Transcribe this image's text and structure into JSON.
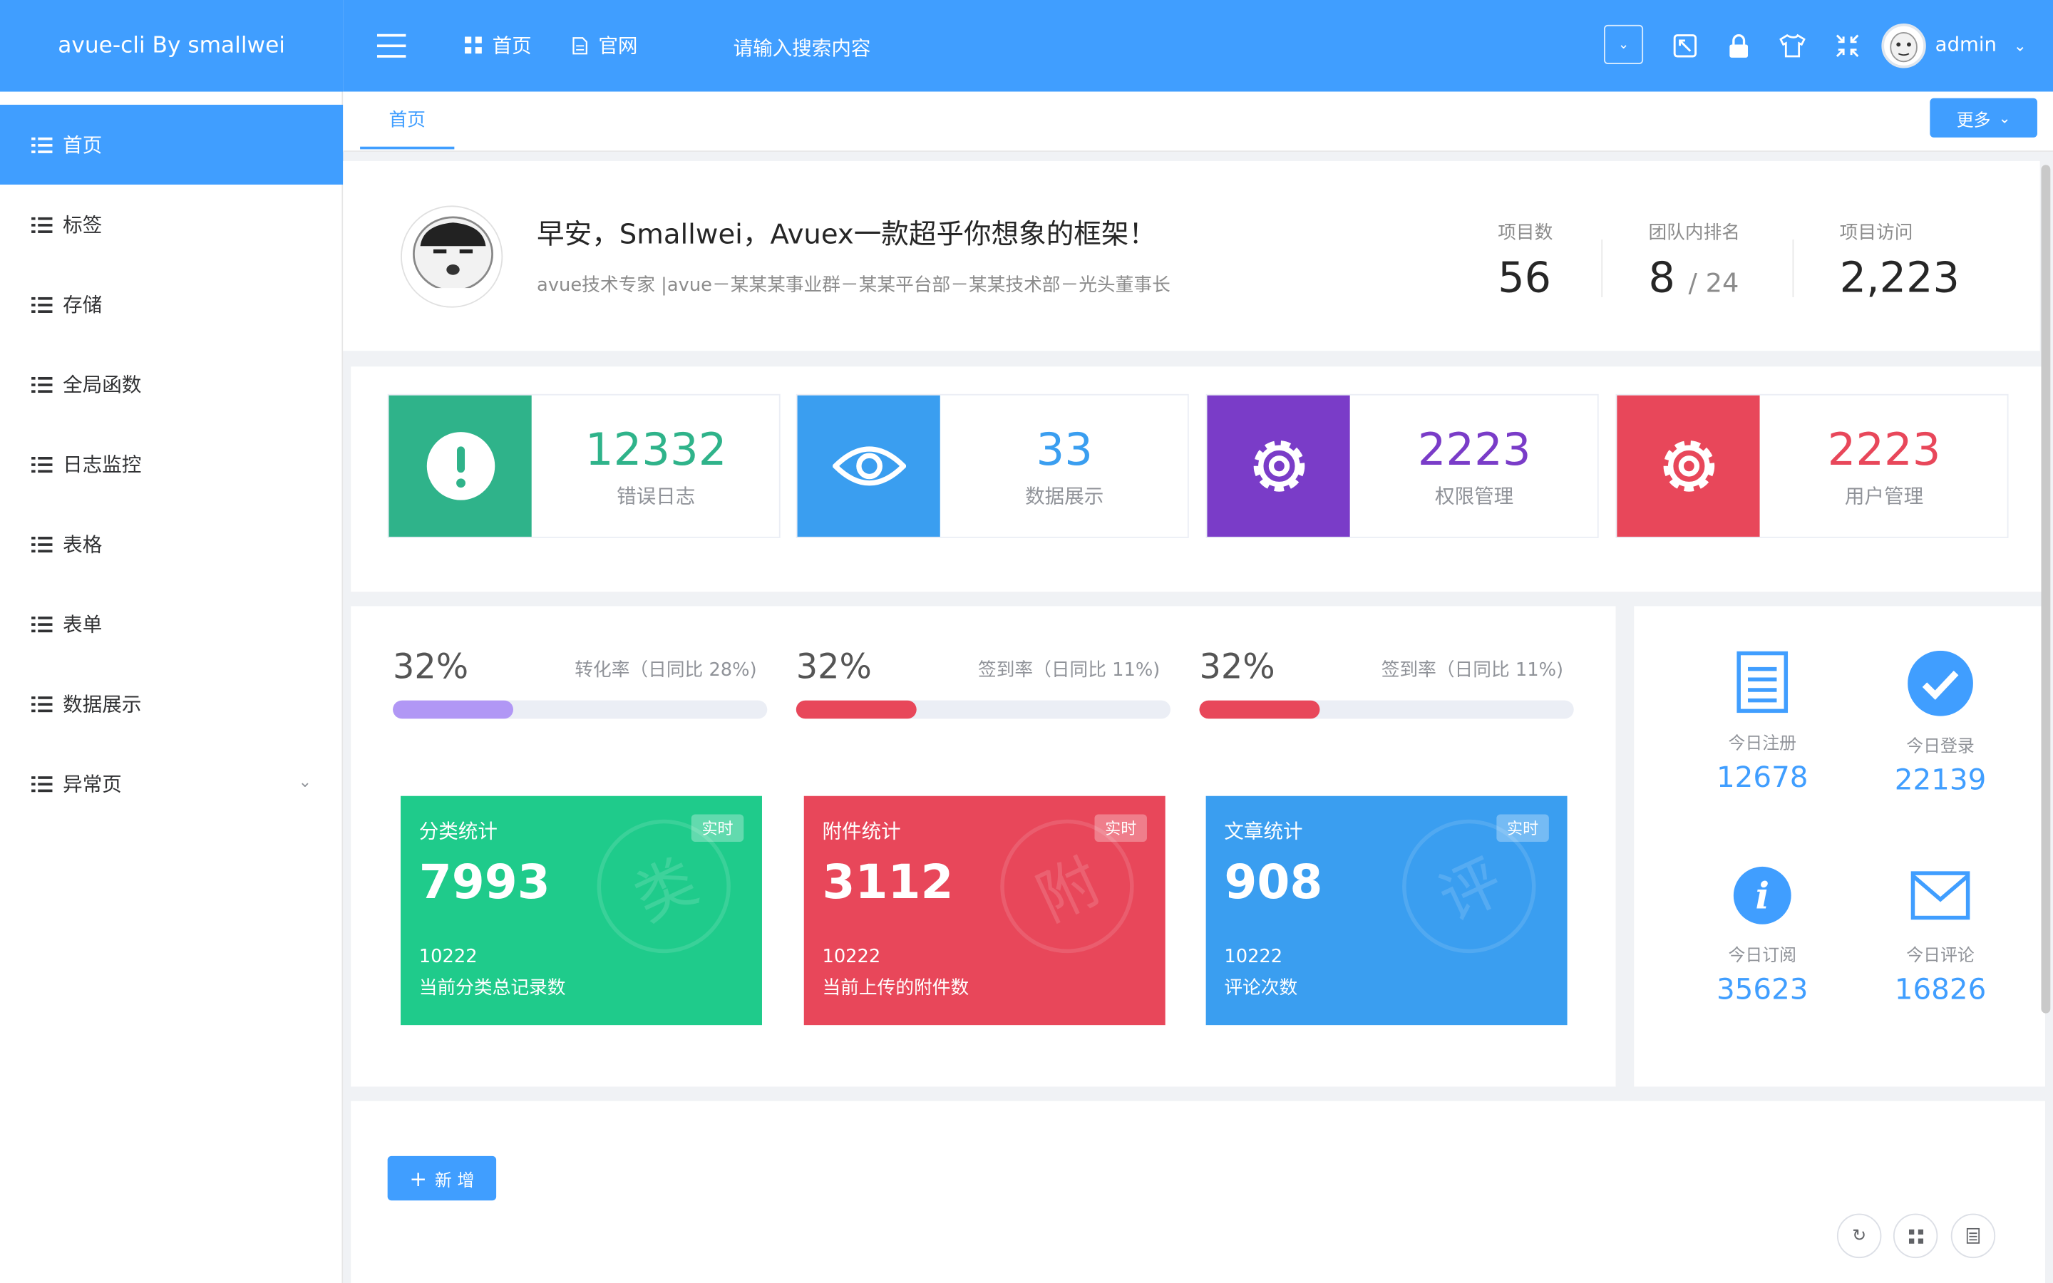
{
  "app": {
    "title": "avue-cli By smallwei"
  },
  "sidebar": {
    "items": [
      {
        "label": "首页"
      },
      {
        "label": "标签"
      },
      {
        "label": "存储"
      },
      {
        "label": "全局函数"
      },
      {
        "label": "日志监控"
      },
      {
        "label": "表格"
      },
      {
        "label": "表单"
      },
      {
        "label": "数据展示"
      },
      {
        "label": "异常页"
      }
    ]
  },
  "header": {
    "nav": [
      {
        "label": "首页"
      },
      {
        "label": "官网"
      }
    ],
    "search_placeholder": "请输入搜索内容",
    "user": "admin"
  },
  "tabs": {
    "home": "首页",
    "more": "更多"
  },
  "welcome": {
    "title": "早安，Smallwei，Avuex一款超乎你想象的框架！",
    "subtitle": "avue技术专家 |avue－某某某事业群－某某平台部－某某技术部－光头董事长",
    "stats": [
      {
        "label": "项目数",
        "value": "56"
      },
      {
        "label": "团队内排名",
        "value": "8",
        "suffix": "/ 24"
      },
      {
        "label": "项目访问",
        "value": "2,223"
      }
    ]
  },
  "boxes": [
    {
      "value": "12332",
      "label": "错误日志",
      "color": "#2fb38a",
      "icon": "exclamation-icon"
    },
    {
      "value": "33",
      "label": "数据展示",
      "color": "#3a9ef0",
      "icon": "eye-icon"
    },
    {
      "value": "2223",
      "label": "权限管理",
      "color": "#7a3cc8",
      "icon": "gear-icon"
    },
    {
      "value": "2223",
      "label": "用户管理",
      "color": "#e8475a",
      "icon": "gear-icon"
    }
  ],
  "progress": [
    {
      "percent": "32%",
      "label": "转化率（日同比 28%)",
      "color": "#b197f5",
      "value": 32
    },
    {
      "percent": "32%",
      "label": "签到率（日同比 11%)",
      "color": "#e8475a",
      "value": 32
    },
    {
      "percent": "32%",
      "label": "签到率（日同比 11%)",
      "color": "#e8475a",
      "value": 32
    }
  ],
  "stat_cards": [
    {
      "title": "分类统计",
      "badge": "实时",
      "value": "7993",
      "sub_value": "10222",
      "desc": "当前分类总记录数",
      "color": "#1fcb8b",
      "watermark": "类"
    },
    {
      "title": "附件统计",
      "badge": "实时",
      "value": "3112",
      "sub_value": "10222",
      "desc": "当前上传的附件数",
      "color": "#e8475a",
      "watermark": "附"
    },
    {
      "title": "文章统计",
      "badge": "实时",
      "value": "908",
      "sub_value": "10222",
      "desc": "评论次数",
      "color": "#3a9ef0",
      "watermark": "评"
    }
  ],
  "today": [
    {
      "label": "今日注册",
      "value": "12678",
      "icon": "document-icon"
    },
    {
      "label": "今日登录",
      "value": "22139",
      "icon": "check-circle-icon"
    },
    {
      "label": "今日订阅",
      "value": "35623",
      "icon": "info-icon"
    },
    {
      "label": "今日评论",
      "value": "16826",
      "icon": "mail-icon"
    }
  ],
  "crud": {
    "add_label": "新 增"
  }
}
